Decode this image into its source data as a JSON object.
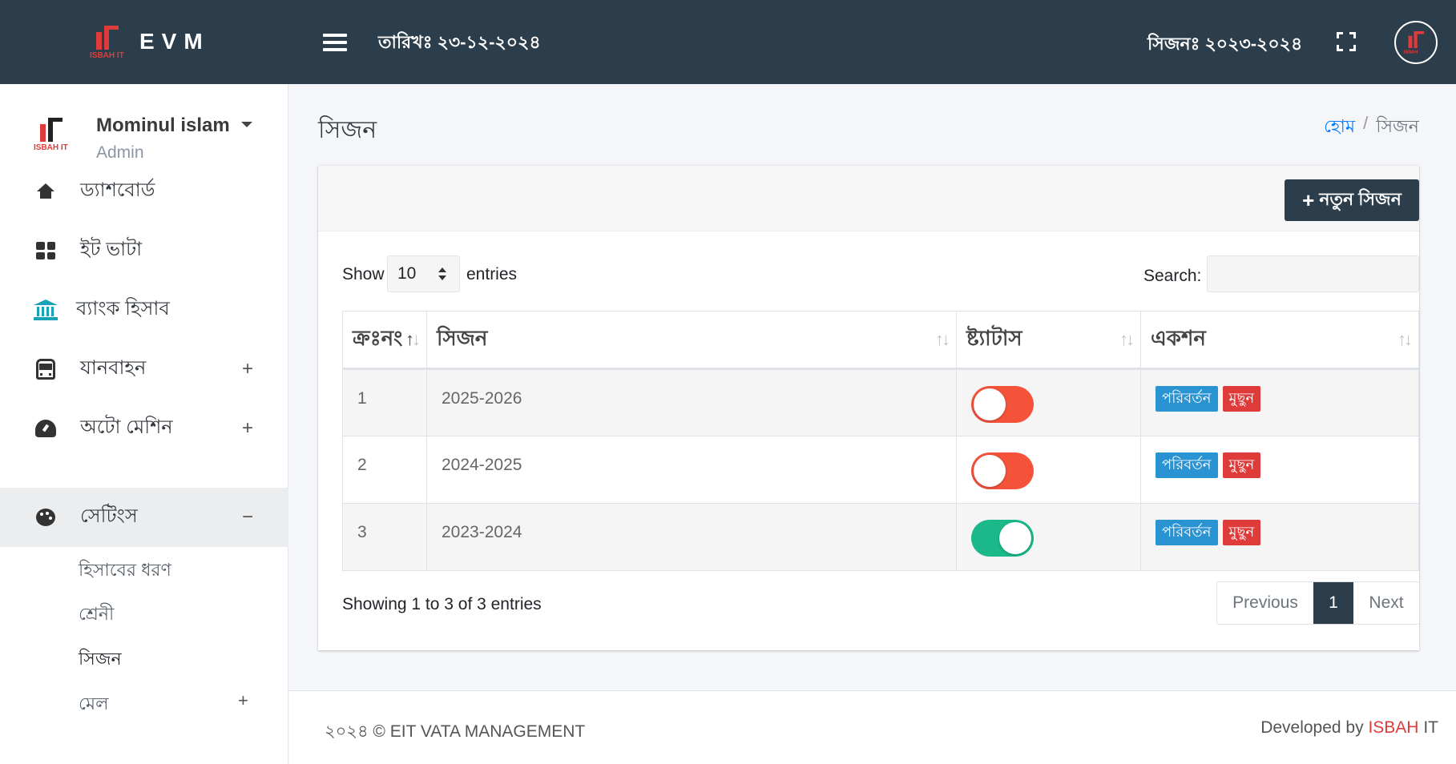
{
  "topbar": {
    "logo_text": "ISBAH IT",
    "brand": "EVM",
    "date_text": "তারিখঃ ২৩-১২-২০২৪",
    "season_text": "সিজনঃ ২০২৩-২০২৪",
    "avatar_logo_text": "ISBAH"
  },
  "user": {
    "logo_text": "ISBAH IT",
    "name": "Mominul islam",
    "role": "Admin"
  },
  "sidebar": {
    "items": [
      {
        "label": "ড্যাশবোর্ড",
        "icon": "home-icon"
      },
      {
        "label": "ইট ভাটা",
        "icon": "grid-icon"
      },
      {
        "label": "ব্যাংক হিসাব",
        "icon": "bank-icon"
      },
      {
        "label": "যানবাহন",
        "icon": "bus-icon",
        "toggle": "+"
      },
      {
        "label": "অটো মেশিন",
        "icon": "gauge-icon",
        "toggle": "+"
      },
      {
        "label": "সেটিংস",
        "icon": "palette-icon",
        "toggle": "−"
      }
    ],
    "subitems": [
      {
        "label": "হিসাবের ধরণ"
      },
      {
        "label": "শ্রেনী"
      },
      {
        "label": "সিজন"
      },
      {
        "label": "মেল",
        "toggle": "+"
      }
    ]
  },
  "page": {
    "title": "সিজন",
    "breadcrumb_home": "হোম",
    "breadcrumb_sep": "/",
    "breadcrumb_current": "সিজন"
  },
  "card": {
    "new_button_label": "নতুন সিজন",
    "new_button_icon": "+",
    "show_label": "Show",
    "page_length": "10",
    "entries_label": "entries",
    "search_label": "Search:",
    "search_value": "",
    "columns": [
      "ক্রঃনং",
      "সিজন",
      "ষ্ট্যাটাস",
      "একশন"
    ],
    "rows": [
      {
        "serial": "1",
        "season": "2025-2026",
        "active": false,
        "edit": "পরিবর্তন",
        "delete": "মুছুন"
      },
      {
        "serial": "2",
        "season": "2024-2025",
        "active": false,
        "edit": "পরিবর্তন",
        "delete": "মুছুন"
      },
      {
        "serial": "3",
        "season": "2023-2024",
        "active": true,
        "edit": "পরিবর্তন",
        "delete": "মুছুন"
      }
    ],
    "info": "Showing 1 to 3 of 3 entries",
    "pager": {
      "previous": "Previous",
      "current": "1",
      "next": "Next"
    }
  },
  "footer": {
    "left": "২০২৪ © EIT VATA MANAGEMENT",
    "right_prefix": "Developed by",
    "right_brand": "ISBAH",
    "right_suffix": "IT"
  },
  "colors": {
    "topbar": "#2c3e4c",
    "accent_red": "#e03b3b",
    "edit_blue": "#2a94d3",
    "toggle_on": "#1bb88a",
    "toggle_off": "#f4533a"
  }
}
